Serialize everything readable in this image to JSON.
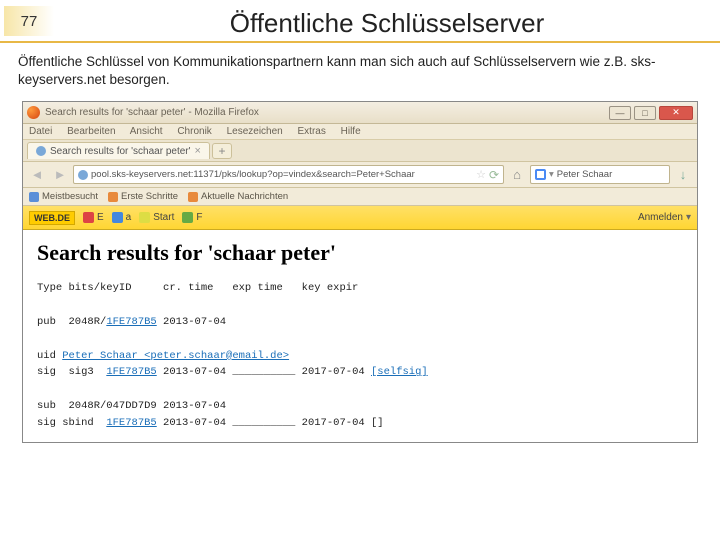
{
  "slide": {
    "number": "77",
    "title": "Öffentliche Schlüsselserver",
    "body": "Öffentliche Schlüssel von Kommunikationspartnern kann man sich auch auf Schlüsselservern wie z.B. sks-keyservers.net besorgen."
  },
  "browser": {
    "window_title": "Search results for 'schaar peter' - Mozilla Firefox",
    "menu": {
      "datei": "Datei",
      "bearbeiten": "Bearbeiten",
      "ansicht": "Ansicht",
      "chronik": "Chronik",
      "lesezeichen": "Lesezeichen",
      "extras": "Extras",
      "hilfe": "Hilfe"
    },
    "tab_label": "Search results for 'schaar peter'",
    "url": "pool.sks-keyservers.net:11371/pks/lookup?op=vindex&search=Peter+Schaar",
    "search_value": "Peter Schaar",
    "bookmarks": {
      "meist": "Meistbesucht",
      "erste": "Erste Schritte",
      "aktuell": "Aktuelle Nachrichten"
    },
    "portal": {
      "brand": "WEB.DE",
      "a": "E",
      "b": "a",
      "c": "Start",
      "d": "F",
      "login": "Anmelden"
    }
  },
  "result": {
    "heading": "Search results for 'schaar peter'",
    "cols": "Type bits/keyID     cr. time   exp time   key expir",
    "l1a": "pub  2048R/",
    "l1b": "1FE787B5",
    "l1c": " 2013-07-04",
    "l2a": "uid ",
    "l2b": "Peter Schaar <peter.schaar@email.de>",
    "l3a": "sig  sig3  ",
    "l3b": "1FE787B5",
    "l3c": " 2013-07-04 __________ 2017-07-04 ",
    "l3d": "[selfsig]",
    "l4": "sub  2048R/047DD7D9 2013-07-04",
    "l5a": "sig sbind  ",
    "l5b": "1FE787B5",
    "l5c": " 2013-07-04 __________ 2017-07-04 []"
  }
}
